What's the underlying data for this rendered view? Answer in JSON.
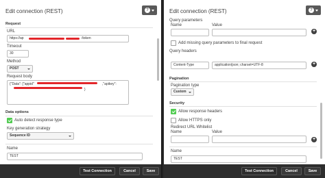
{
  "left": {
    "title": "Edit connection (REST)",
    "help_icon": "help-icon",
    "section_request": "Request",
    "url_label": "URL",
    "url_value_start": "https://ap",
    "url_value_end": "/token",
    "timeout_label": "Timeout",
    "timeout_value": "30",
    "method_label": "Method",
    "method_value": "POST",
    "body_label": "Request body",
    "body_value_start": "{\"Data\": [\"appid\"",
    "body_value_mid": ",\"apikey\":",
    "body_value_end": "}",
    "section_data_options": "Data options",
    "auto_detect_label": "Auto detect response type",
    "auto_detect_checked": true,
    "keygen_label": "Key generation strategy",
    "keygen_value": "Sequence ID",
    "name_label": "Name",
    "name_value": "TEST",
    "footer": {
      "test": "Test Connection",
      "cancel": "Cancel",
      "save": "Save"
    }
  },
  "right": {
    "title": "Edit connection (REST)",
    "qp_label": "Query parameters",
    "qp_name_col": "Name",
    "qp_value_col": "Value",
    "add_missing_label": "Add missing query parameters to final request",
    "add_missing_checked": false,
    "qh_label": "Query headers",
    "qh_name_value": "Content-Type",
    "qh_value_value": "application/json; charset=UTF-8",
    "section_pagination": "Pagination",
    "pagination_type_label": "Pagination type",
    "pagination_type_value": "Custom",
    "section_security": "Security",
    "allow_response_headers_label": "Allow response headers",
    "allow_response_headers_checked": true,
    "allow_https_label": "Allow HTTPS only",
    "allow_https_checked": false,
    "redirect_label": "Redirect URL Whitelist",
    "redirect_name_col": "Name",
    "redirect_value_col": "Value",
    "name_label": "Name",
    "name_value": "TEST",
    "footer": {
      "test": "Test Connection",
      "cancel": "Cancel",
      "save": "Save"
    }
  },
  "colors": {
    "accent_green": "#52cc52",
    "footer_bg": "#2e2e2e",
    "redaction": "#e3262a"
  }
}
